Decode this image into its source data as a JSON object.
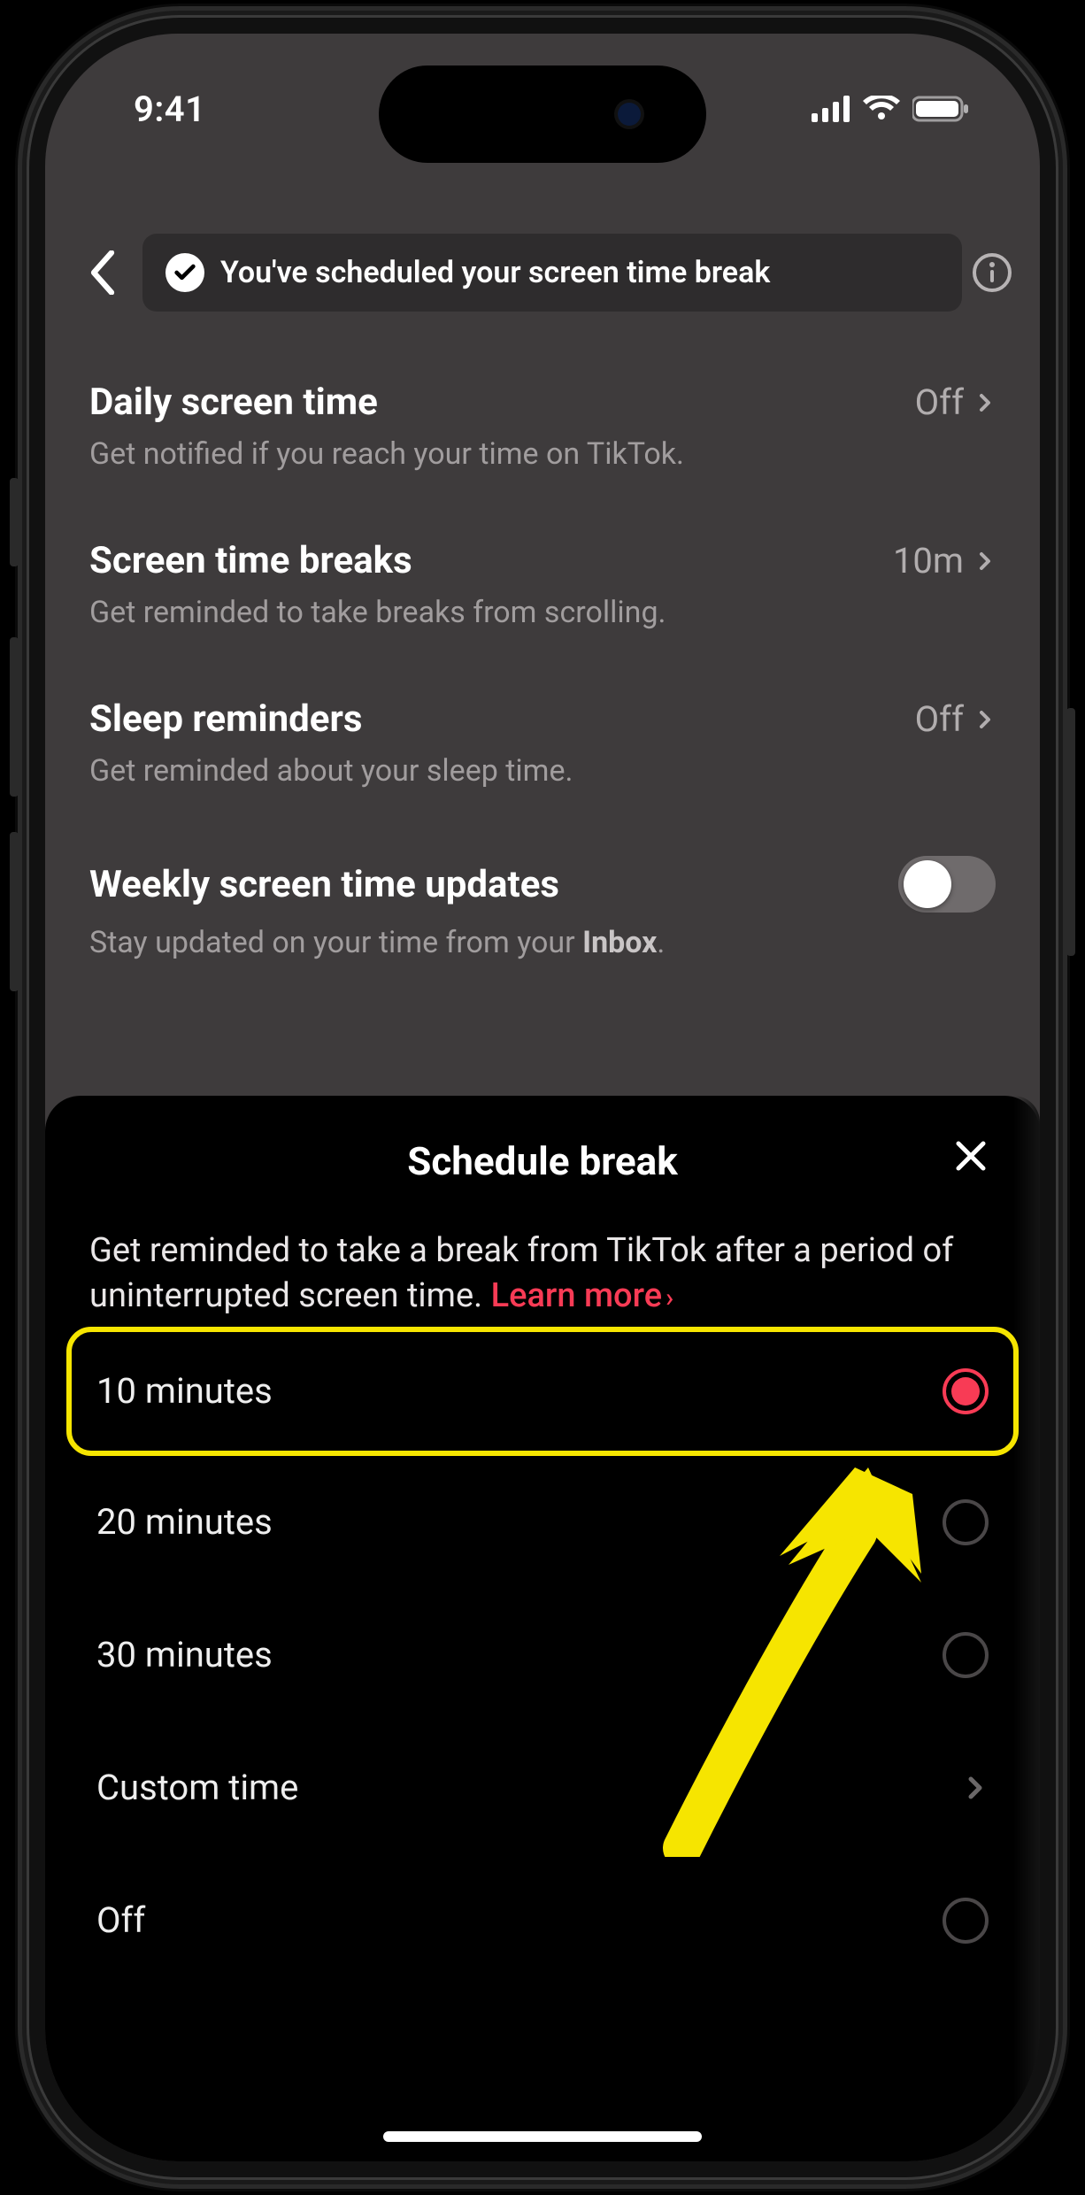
{
  "status": {
    "time": "9:41"
  },
  "header": {
    "toast": "You've scheduled your screen time break"
  },
  "settings": {
    "daily": {
      "title": "Daily screen time",
      "value": "Off",
      "sub": "Get notified if you reach your time on TikTok."
    },
    "breaks": {
      "title": "Screen time breaks",
      "value": "10m",
      "sub": "Get reminded to take breaks from scrolling."
    },
    "sleep": {
      "title": "Sleep reminders",
      "value": "Off",
      "sub": "Get reminded about your sleep time."
    },
    "weekly": {
      "title": "Weekly screen time updates",
      "sub_pre": "Stay updated on your time from your ",
      "sub_bold": "Inbox",
      "sub_post": "."
    }
  },
  "sheet": {
    "title": "Schedule break",
    "desc": "Get reminded to take a break from TikTok after a period of uninterrupted screen time. ",
    "learn": "Learn more",
    "options": {
      "o10": "10 minutes",
      "o20": "20 minutes",
      "o30": "30 minutes",
      "custom": "Custom time",
      "off": "Off"
    }
  }
}
